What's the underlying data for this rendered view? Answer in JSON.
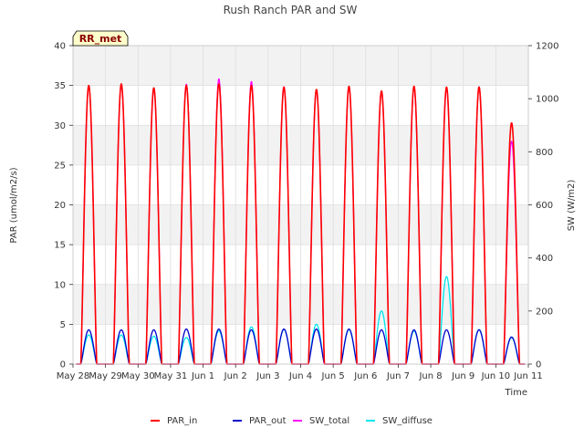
{
  "chart_data": {
    "type": "line",
    "title": "Rush Ranch PAR and SW",
    "xlabel": "Time",
    "ylabel_left": "PAR (umol/m2/s)",
    "ylabel_right": "SW (W/m2)",
    "ylim_left": [
      0,
      40
    ],
    "ylim_right": [
      0,
      1200
    ],
    "yticks_left": [
      0,
      5,
      10,
      15,
      20,
      25,
      30,
      35,
      40
    ],
    "yticks_right": [
      0,
      200,
      400,
      600,
      800,
      1000,
      1200
    ],
    "x_start": "May 28",
    "x_end": "Jun 11",
    "xticks": [
      "May 28",
      "May 29",
      "May 30",
      "May 31",
      "Jun 1",
      "Jun 2",
      "Jun 3",
      "Jun 4",
      "Jun 5",
      "Jun 6",
      "Jun 7",
      "Jun 8",
      "Jun 9",
      "Jun 10",
      "Jun 11"
    ],
    "grid": true,
    "legend_position": "bottom",
    "station_badge": "RR_met",
    "diurnal_model": {
      "sunrise_day_fraction": 0.24,
      "sunset_day_fraction": 0.73,
      "day_offset_from_first_tick": 0.0,
      "last_day_end": 13.9
    },
    "series": [
      {
        "name": "PAR_in",
        "axis": "left",
        "color": "#ff0000",
        "daily_peak": [
          35.0,
          35.2,
          34.7,
          35.0,
          35.2,
          35.0,
          34.8,
          34.5,
          34.9,
          34.3,
          34.9,
          34.8,
          34.8,
          30.3
        ]
      },
      {
        "name": "PAR_out",
        "axis": "left",
        "color": "#0000cc",
        "daily_peak": [
          4.3,
          4.3,
          4.3,
          4.4,
          4.4,
          4.3,
          4.4,
          4.4,
          4.4,
          4.3,
          4.3,
          4.3,
          4.3,
          3.4
        ]
      },
      {
        "name": "SW_total",
        "axis": "right",
        "color": "#ff00ff",
        "daily_peak": [
          1050,
          1055,
          1040,
          1055,
          1075,
          1065,
          1045,
          1035,
          1045,
          1030,
          1045,
          1040,
          1045,
          840
        ]
      },
      {
        "name": "SW_diffuse",
        "axis": "right",
        "color": "#00e5ee",
        "daily_peak": [
          110,
          110,
          105,
          100,
          125,
          140,
          130,
          150,
          130,
          200,
          125,
          330,
          130,
          100
        ]
      }
    ]
  }
}
